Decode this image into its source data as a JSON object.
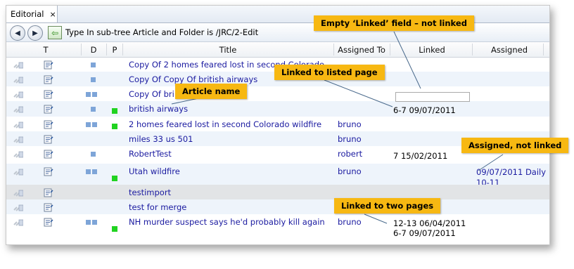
{
  "tab": {
    "label": "Editorial",
    "close": "×"
  },
  "toolbar": {
    "back_icon": "◀",
    "forward_icon": "▶",
    "up_icon": "⇦",
    "path_text": "Type In sub-tree Article and Folder is /JRC/2-Edit"
  },
  "columns": {
    "t": "T",
    "d": "D",
    "p": "P",
    "title": "Title",
    "assigned_to": "Assigned To",
    "linked": "Linked",
    "assigned": "Assigned"
  },
  "rows": [
    {
      "title": "Copy Of 2 homes feared lost in second Colorado",
      "d": 1,
      "p": false,
      "assigned_to": "",
      "linked": [],
      "assigned": []
    },
    {
      "title": "Copy Of Copy Of british airways",
      "d": 1,
      "p": false,
      "assigned_to": "",
      "linked": [],
      "assigned": []
    },
    {
      "title": "Copy Of bri",
      "d": 2,
      "p": false,
      "assigned_to": "",
      "linked": [],
      "assigned": []
    },
    {
      "title": "british airways",
      "d": 1,
      "p": true,
      "assigned_to": "",
      "linked": [
        "6-7 09/07/2011"
      ],
      "assigned": []
    },
    {
      "title": "2 homes feared lost in second Colorado wildfire",
      "d": 2,
      "p": true,
      "assigned_to": "bruno",
      "linked": [],
      "assigned": []
    },
    {
      "title": "miles 33 us 501",
      "d": 0,
      "p": false,
      "assigned_to": "bruno",
      "linked": [],
      "assigned": []
    },
    {
      "title": "RobertTest",
      "d": 1,
      "p": false,
      "assigned_to": "robert",
      "linked": [
        "7 15/02/2011"
      ],
      "assigned": []
    },
    {
      "title": "Utah wildfire",
      "d": 2,
      "p": true,
      "assigned_to": "bruno",
      "linked": [],
      "assigned": [
        "09/07/2011 Daily",
        "10-11"
      ]
    },
    {
      "title": "testimport",
      "d": 0,
      "p": false,
      "assigned_to": "",
      "linked": [],
      "assigned": []
    },
    {
      "title": "test for merge",
      "d": 0,
      "p": false,
      "assigned_to": "",
      "linked": [],
      "assigned": []
    },
    {
      "title": "NH murder suspect says he'd probably kill again",
      "d": 2,
      "p": true,
      "assigned_to": "bruno",
      "linked": [
        "12-13 06/04/2011",
        "6-7 09/07/2011"
      ],
      "assigned": []
    }
  ],
  "callouts": {
    "empty_linked": "Empty ‘Linked’ field – not linked",
    "linked_listed": "Linked to listed page",
    "article_name": "Article name",
    "assigned_not_linked": "Assigned, not linked",
    "linked_two": "Linked to two pages"
  },
  "colors": {
    "callout_bg": "#f7b812",
    "link_text": "#1a1aa0",
    "d_marker": "#7ea5d8",
    "p_marker": "#21d321"
  }
}
